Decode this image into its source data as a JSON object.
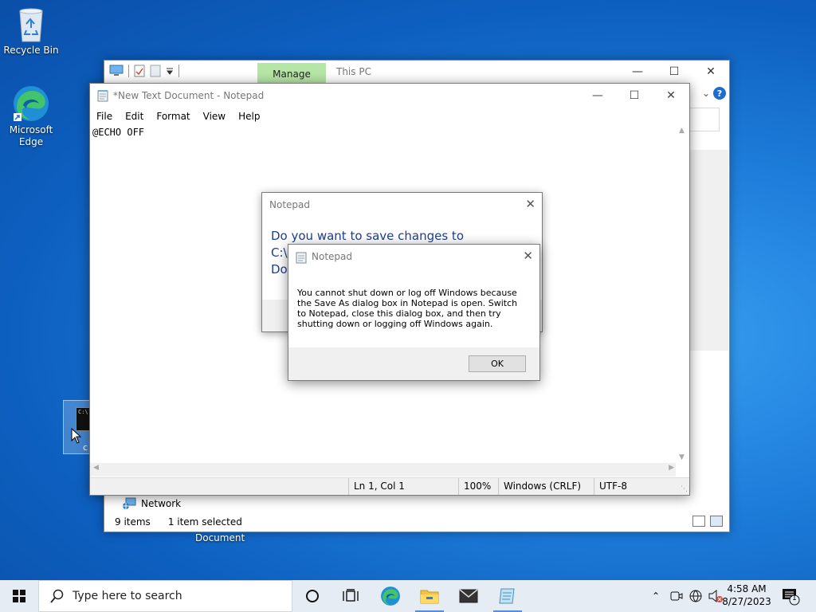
{
  "desktop": {
    "icons": [
      {
        "label": "Recycle Bin"
      },
      {
        "label": "Microsoft Edge"
      }
    ],
    "shortcut_partial_label": "c"
  },
  "explorer": {
    "ribbon_tab": "Manage",
    "title": "This PC",
    "nav_item": "Network",
    "status_items": "9 items",
    "status_selected": "1 item selected",
    "help_label": "?"
  },
  "desktop_document_label": "Document",
  "notepad": {
    "title": "*New Text Document - Notepad",
    "menu": [
      "File",
      "Edit",
      "Format",
      "View",
      "Help"
    ],
    "content": "@ECHO OFF",
    "status": {
      "position": "Ln 1, Col 1",
      "zoom": "100%",
      "line_ending": "Windows (CRLF)",
      "encoding": "UTF-8"
    }
  },
  "save_dialog": {
    "title": "Notepad",
    "question_line1": "Do you want to save changes to",
    "question_line2": "C:\\U",
    "question_line3": "Doc"
  },
  "error_dialog": {
    "title": "Notepad",
    "message": "You cannot shut down or log off Windows because the Save As dialog box in Notepad is open. Switch to Notepad, close this dialog box, and then try shutting down or logging off Windows again.",
    "ok_label": "OK"
  },
  "taskbar": {
    "search_placeholder": "Type here to search",
    "time": "4:58 AM",
    "date": "8/27/2023",
    "notification_count": "1"
  },
  "colors": {
    "accent": "#1c6fd1",
    "manage_tab": "#b5e6a5",
    "dialog_heading": "#1e3f8f"
  }
}
